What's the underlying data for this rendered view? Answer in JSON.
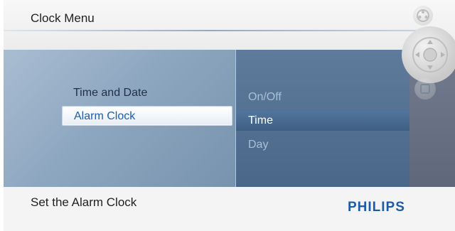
{
  "header": {
    "title": "Clock Menu"
  },
  "menu": {
    "left_items": [
      {
        "label": "Time and Date"
      },
      {
        "label": "Alarm Clock"
      }
    ],
    "right_items": [
      {
        "label": "On/Off"
      },
      {
        "label": "Time"
      },
      {
        "label": "Day"
      }
    ]
  },
  "footer": {
    "status": "Set the Alarm Clock",
    "brand": "PHILIPS"
  },
  "icons": {
    "top": "reel-icon",
    "middle": "navigation-pad-icon",
    "bottom": "settings-icon"
  },
  "colors": {
    "accent": "#1f5aa8",
    "menu_background": "#496789",
    "selected_text": "#1e5ea8"
  }
}
